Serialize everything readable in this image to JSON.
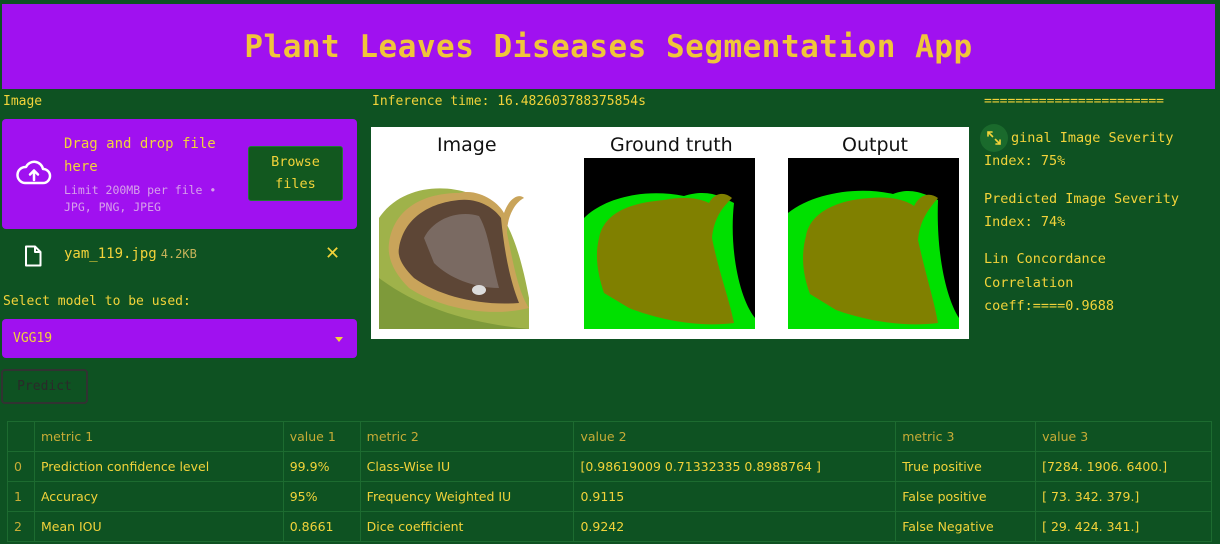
{
  "app": {
    "title": "Plant Leaves Diseases Segmentation App"
  },
  "uploader": {
    "label": "Image",
    "drag_text": "Drag and drop file here",
    "limit_text": "Limit 200MB per file • JPG, PNG, JPEG",
    "browse_label": "Browse files",
    "icon": "cloud-upload-icon"
  },
  "uploaded_file": {
    "name": "yam_119.jpg",
    "size": "4.2KB",
    "icon": "file-icon",
    "remove_icon": "close-icon"
  },
  "model_select": {
    "label": "Select model to be used:",
    "selected": "VGG19"
  },
  "predict_button": {
    "label": "Predict"
  },
  "inference": {
    "text": "Inference time: 16.482603788375854s"
  },
  "figure": {
    "panels": [
      {
        "title": "Image"
      },
      {
        "title": "Ground truth"
      },
      {
        "title": "Output"
      }
    ]
  },
  "results": {
    "separator": "=======================",
    "original_severity": "Original Image Severity Index: 75%",
    "original_severity_visible": "ginal Image Severity",
    "original_severity_line2": "Index: 75%",
    "predicted_severity_line1": "Predicted Image Severity",
    "predicted_severity_line2": "Index: 74%",
    "lin_line1": "Lin Concordance",
    "lin_line2": "Correlation",
    "lin_line3": "coeff:====0.9688"
  },
  "metrics_table": {
    "columns": [
      "",
      "metric 1",
      "value 1",
      "metric 2",
      "value 2",
      "metric 3",
      "value 3"
    ],
    "rows": [
      [
        "0",
        "Prediction confidence level",
        "99.9%",
        "Class-Wise IU",
        "[0.98619009 0.71332335 0.8988764 ]",
        "True positive",
        "[7284. 1906. 6400.]"
      ],
      [
        "1",
        "Accuracy",
        "95%",
        "Frequency Weighted IU",
        "0.9115",
        "False positive",
        "[ 73. 342. 379.]"
      ],
      [
        "2",
        "Mean IOU",
        "0.8661",
        "Dice coefficient",
        "0.9242",
        "False Negative",
        "[ 29. 424. 341.]"
      ]
    ]
  },
  "colors": {
    "background": "#0e5222",
    "accent_purple": "#a011f0",
    "text_yellow": "#f2d33a",
    "mask_olive": "#808000",
    "mask_green": "#00e000"
  }
}
